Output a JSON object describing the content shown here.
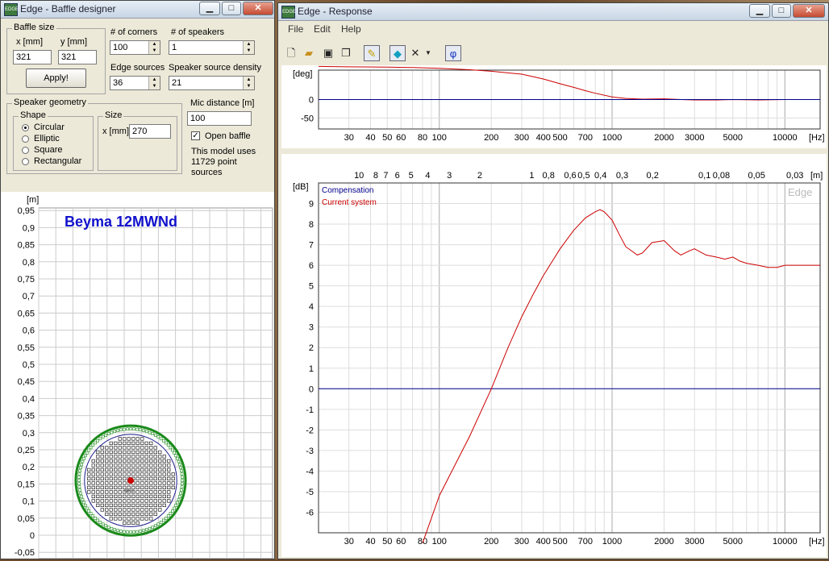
{
  "baffle_window": {
    "title": "Edge - Baffle designer",
    "baffle_size": {
      "group_label": "Baffle size",
      "x_label": "x [mm]",
      "y_label": "y [mm]",
      "x_value": "321",
      "y_value": "321",
      "apply_label": "Apply!"
    },
    "corners": {
      "label": "# of corners",
      "value": "100"
    },
    "speakers": {
      "label": "# of speakers",
      "value": "1"
    },
    "edge_sources": {
      "label": "Edge sources",
      "value": "36"
    },
    "speaker_density": {
      "label": "Speaker source density",
      "value": "21"
    },
    "speaker_geometry": {
      "group_label": "Speaker geometry",
      "shape_label": "Shape",
      "shapes": [
        "Circular",
        "Elliptic",
        "Square",
        "Rectangular"
      ],
      "selected_shape": "Circular",
      "size_label": "Size",
      "size_x_label": "x [mm]",
      "size_x_value": "270"
    },
    "mic_distance": {
      "label": "Mic distance [m]",
      "value": "100"
    },
    "open_baffle": {
      "label": "Open baffle",
      "checked": true
    },
    "model_info": [
      "This model uses",
      "11729 point",
      "sources"
    ],
    "plot": {
      "unit": "[m]",
      "title": "Beyma 12MWNd",
      "mic_label": "mic",
      "y_ticks": [
        "0,95",
        "0,9",
        "0,85",
        "0,8",
        "0,75",
        "0,7",
        "0,65",
        "0,6",
        "0,55",
        "0,5",
        "0,45",
        "0,4",
        "0,35",
        "0,3",
        "0,25",
        "0,2",
        "0,15",
        "0,1",
        "0,05",
        "0",
        "-0,05"
      ],
      "title_color": "#1010cc",
      "edge_color": "#1a8a1a",
      "speaker_color": "#000000",
      "mic_color": "#cc0000"
    }
  },
  "response_window": {
    "title": "Edge - Response",
    "menu": [
      "File",
      "Edit",
      "Help"
    ],
    "toolbar_icons": [
      "new-file-icon",
      "open-folder-icon",
      "save-disk-icon",
      "copy-icon",
      "pencil-icon",
      "speaker-icon",
      "close-x-icon",
      "dropdown-arrow-icon",
      "phi-icon"
    ],
    "phase_label": "φ"
  },
  "chart_data": [
    {
      "type": "line",
      "ylabel": "[deg]",
      "xlabel": "[Hz]",
      "x_scale": "log",
      "xlim": [
        20,
        16000
      ],
      "ylim": [
        -80,
        80
      ],
      "y_ticks": [
        "0",
        "-50"
      ],
      "x_ticks": [
        "30",
        "40",
        "50",
        "60",
        "80",
        "100",
        "200",
        "300",
        "400",
        "500",
        "700",
        "1000",
        "2000",
        "3000",
        "5000",
        "10000"
      ],
      "series": [
        {
          "color": "#cc0000",
          "x": [
            20,
            30,
            50,
            70,
            100,
            150,
            200,
            300,
            400,
            500,
            600,
            700,
            800,
            1000,
            1200,
            1500,
            2000,
            2500,
            3000,
            4000,
            5000,
            7000,
            10000,
            16000
          ],
          "y": [
            90,
            89,
            88,
            87,
            85,
            81,
            77,
            69,
            56,
            43,
            33,
            24,
            17,
            7,
            3,
            1,
            2,
            0,
            -1,
            -1,
            0,
            -1,
            0,
            0
          ]
        },
        {
          "color": "#000088",
          "x": [
            20,
            16000
          ],
          "y": [
            0,
            0
          ]
        }
      ]
    },
    {
      "type": "line",
      "ylabel": "[dB]",
      "xlabel": "[Hz]",
      "x_scale": "log",
      "xlim": [
        20,
        16000
      ],
      "ylim": [
        -7,
        10
      ],
      "y_ticks": [
        "9",
        "8",
        "7",
        "6",
        "5",
        "4",
        "3",
        "2",
        "1",
        "0",
        "-1",
        "-2",
        "-3",
        "-4",
        "-5",
        "-6"
      ],
      "x_ticks": [
        "30",
        "40",
        "50",
        "60",
        "80",
        "100",
        "200",
        "300",
        "400",
        "500",
        "700",
        "1000",
        "2000",
        "3000",
        "5000",
        "10000"
      ],
      "top_axis_unit": "[m]",
      "top_axis_ticks": [
        "10",
        "8",
        "7",
        "6",
        "5",
        "4",
        "3",
        "2",
        "1",
        "0,8",
        "0,6",
        "0,5",
        "0,4",
        "0,3",
        "0,2",
        "0,1",
        "0,08",
        "0,05",
        "0,03"
      ],
      "watermark": "Edge",
      "series": [
        {
          "name": "Compensation",
          "color": "#000088",
          "x": [
            20,
            16000
          ],
          "y": [
            0,
            0
          ]
        },
        {
          "name": "Current system",
          "color": "#cc0000",
          "x": [
            80,
            100,
            150,
            200,
            250,
            300,
            350,
            400,
            500,
            600,
            700,
            800,
            850,
            900,
            1000,
            1100,
            1200,
            1400,
            1500,
            1700,
            2000,
            2300,
            2500,
            2800,
            3000,
            3500,
            4000,
            4500,
            5000,
            5500,
            6000,
            7000,
            8000,
            9000,
            10000,
            12000,
            14000,
            16000
          ],
          "y": [
            -7.5,
            -5.2,
            -2.3,
            0,
            2.0,
            3.5,
            4.6,
            5.5,
            6.8,
            7.7,
            8.3,
            8.6,
            8.7,
            8.6,
            8.2,
            7.5,
            6.9,
            6.5,
            6.6,
            7.1,
            7.2,
            6.7,
            6.5,
            6.7,
            6.8,
            6.5,
            6.4,
            6.3,
            6.4,
            6.2,
            6.1,
            6.0,
            5.9,
            5.9,
            6.0,
            6.0,
            6.0,
            6.0
          ]
        }
      ]
    }
  ]
}
